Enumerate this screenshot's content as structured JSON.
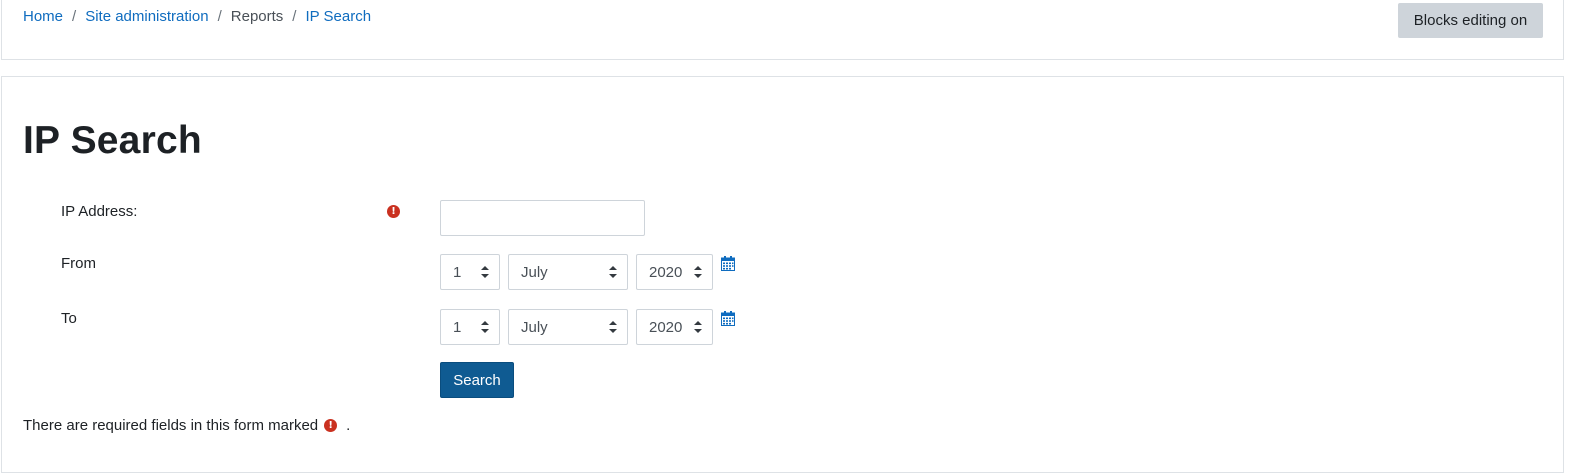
{
  "breadcrumb": {
    "items": [
      {
        "label": "Home",
        "link": true
      },
      {
        "label": "Site administration",
        "link": true
      },
      {
        "label": "Reports",
        "link": false
      },
      {
        "label": "IP Search",
        "link": true
      }
    ],
    "separator": "/"
  },
  "header": {
    "blocks_editing_label": "Blocks editing on"
  },
  "page": {
    "title": "IP Search"
  },
  "form": {
    "ip_label": "IP Address:",
    "ip_value": "",
    "from_label": "From",
    "to_label": "To",
    "from": {
      "day": "1",
      "month": "July",
      "year": "2020"
    },
    "to": {
      "day": "1",
      "month": "July",
      "year": "2020"
    },
    "search_label": "Search",
    "required_note": "There are required fields in this form marked",
    "required_note_end": ".",
    "required_icon": "exclamation-circle-icon",
    "calendar_icon": "calendar-icon"
  },
  "colors": {
    "link": "#0f6cbf",
    "primary_button": "#0f5b92",
    "secondary_button": "#ced4da",
    "required": "#ca3120",
    "calendar_icon": "#0f6cbf"
  }
}
